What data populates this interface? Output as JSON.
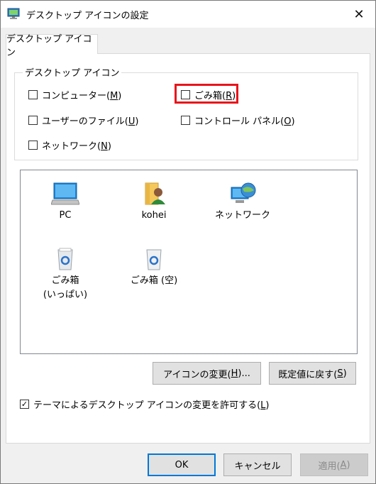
{
  "window": {
    "title": "デスクトップ アイコンの設定"
  },
  "tabs": [
    {
      "label": "デスクトップ アイコン"
    }
  ],
  "group": {
    "label": "デスクトップ アイコン",
    "checkboxes": [
      {
        "text": "コンピューター(",
        "key": "M",
        "end": ")",
        "checked": false
      },
      {
        "text": "ごみ箱(",
        "key": "R",
        "end": ")",
        "checked": false
      },
      {
        "text": "ユーザーのファイル(",
        "key": "U",
        "end": ")",
        "checked": false
      },
      {
        "text": "コントロール パネル(",
        "key": "O",
        "end": ")",
        "checked": false
      },
      {
        "text": "ネットワーク(",
        "key": "N",
        "end": ")",
        "checked": false
      }
    ]
  },
  "preview": {
    "icons": [
      {
        "label": "PC",
        "icon": "computer-icon"
      },
      {
        "label": "kohei",
        "icon": "user-folder-icon"
      },
      {
        "label": "ネットワーク",
        "icon": "network-icon"
      },
      {
        "label": "ごみ箱",
        "label2": "(いっぱい)",
        "icon": "recycle-bin-full-icon"
      },
      {
        "label": "ごみ箱 (空)",
        "icon": "recycle-bin-empty-icon"
      }
    ]
  },
  "buttons": {
    "change_icon": {
      "text": "アイコンの変更(",
      "key": "H",
      "end": ")..."
    },
    "restore_default": {
      "text": "既定値に戻す(",
      "key": "S",
      "end": ")"
    }
  },
  "theme_option": {
    "text": "テーマによるデスクトップ アイコンの変更を許可する(",
    "key": "L",
    "end": ")",
    "checked": true,
    "check_mark": "✓"
  },
  "dialog_buttons": {
    "ok": "OK",
    "cancel": "キャンセル",
    "apply": {
      "text": "適用(",
      "key": "A",
      "end": ")"
    }
  },
  "icons": {
    "close": "✕"
  },
  "colors": {
    "highlight": "#e8141b",
    "accent": "#0078d7"
  }
}
